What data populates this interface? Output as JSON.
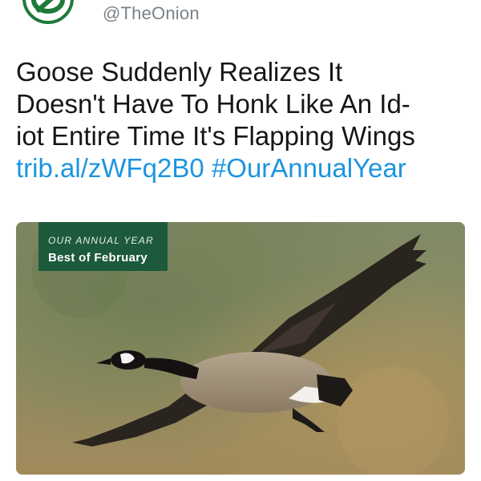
{
  "account": {
    "handle": "@TheOnion",
    "avatar_icon": "onion-logo-icon",
    "brand_color": "#1f7a3a"
  },
  "tweet": {
    "headline_lines": [
      "Goose Suddenly Realizes It",
      "Doesn't Have To Honk Like An Id-",
      "iot Entire Time It's Flapping Wings"
    ],
    "link": "trib.al/zWFq2B0",
    "hashtag": "#OurAnnualYear",
    "link_color": "#1b95e0"
  },
  "media": {
    "banner_top": "OUR ANNUAL YEAR",
    "banner_bottom": "Best of February",
    "banner_color": "#1d5a3c",
    "image_subject": "flying-canada-goose"
  }
}
